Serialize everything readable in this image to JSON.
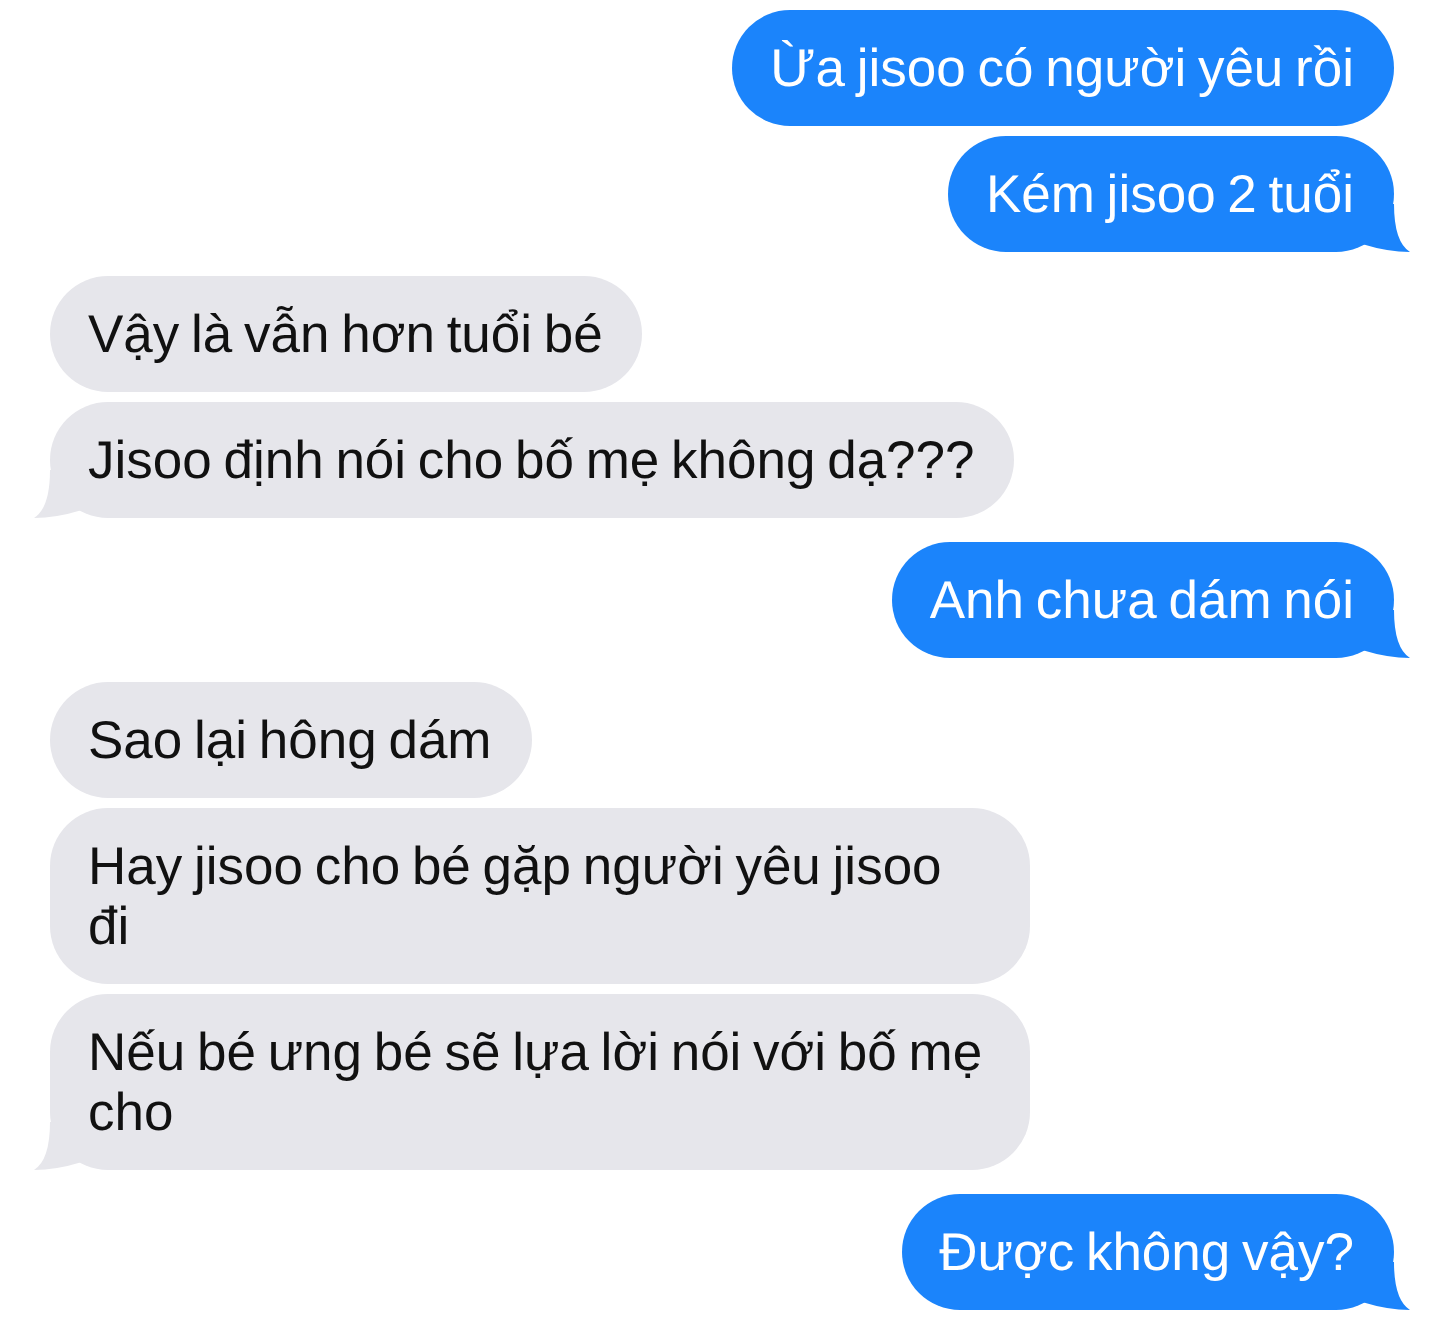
{
  "messages": [
    {
      "kind": "sent",
      "text": "Ừa jisoo có người yêu rồi",
      "tail": false
    },
    {
      "kind": "sent",
      "text": "Kém jisoo 2 tuổi",
      "tail": true
    },
    {
      "kind": "received",
      "text": "Vậy là vẫn hơn tuổi bé",
      "tail": false
    },
    {
      "kind": "received",
      "text": "Jisoo định nói cho bố mẹ không dạ???",
      "tail": true
    },
    {
      "kind": "sent",
      "text": "Anh chưa dám nói",
      "tail": true
    },
    {
      "kind": "received",
      "text": "Sao lại hông dám",
      "tail": false
    },
    {
      "kind": "received",
      "text": "Hay jisoo cho bé gặp người yêu jisoo đi",
      "tail": false
    },
    {
      "kind": "received",
      "text": "Nếu bé ưng bé sẽ lựa lời nói với bố mẹ cho",
      "tail": true
    },
    {
      "kind": "sent",
      "text": "Được không vậy?",
      "tail": true
    }
  ]
}
